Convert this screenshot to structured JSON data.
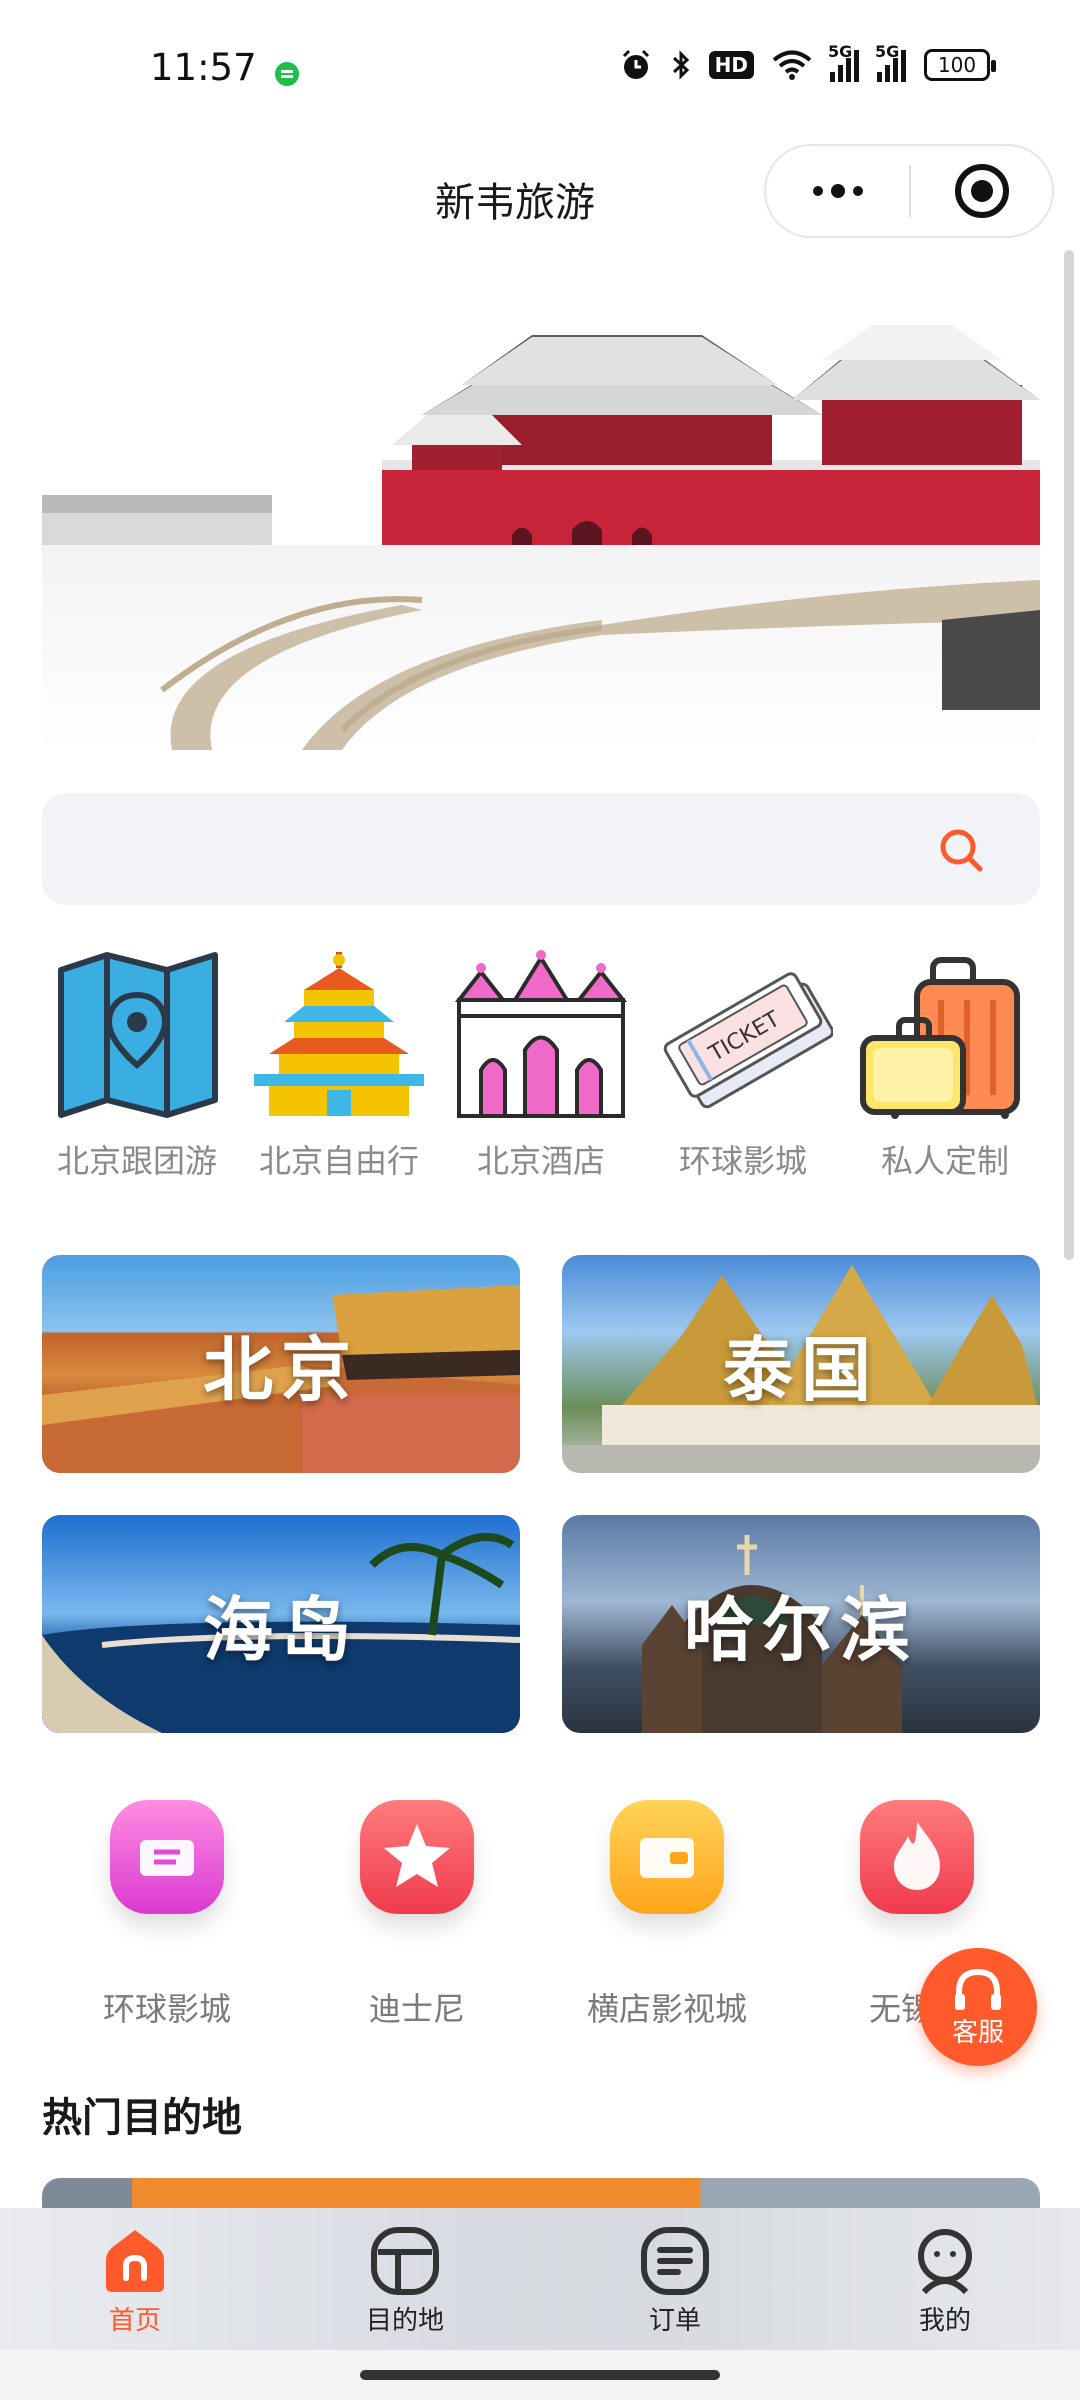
{
  "status_bar": {
    "time": "11:57",
    "hd": "HD",
    "net1": "5G",
    "net2": "5G",
    "battery": "100"
  },
  "header": {
    "title": "新韦旅游"
  },
  "search": {
    "placeholder": ""
  },
  "categories": [
    {
      "label": "北京跟团游",
      "icon": "map-pin-icon"
    },
    {
      "label": "北京自由行",
      "icon": "temple-of-heaven-icon"
    },
    {
      "label": "北京酒店",
      "icon": "castle-icon"
    },
    {
      "label": "环球影城",
      "icon": "ticket-icon"
    },
    {
      "label": "私人定制",
      "icon": "luggage-icon"
    }
  ],
  "destinations": [
    {
      "label": "北京"
    },
    {
      "label": "泰国"
    },
    {
      "label": "海岛"
    },
    {
      "label": "哈尔滨"
    }
  ],
  "quick_links": [
    {
      "label": "环球影城",
      "icon": "ticket-icon",
      "color": "#e14ad8"
    },
    {
      "label": "迪士尼",
      "icon": "star-icon",
      "color": "#ff4d5e"
    },
    {
      "label": "横店影视城",
      "icon": "wallet-icon",
      "color": "#ffb21f"
    },
    {
      "label": "无锡灵",
      "icon": "flame-icon",
      "color": "#ff4d5e"
    }
  ],
  "service_button": {
    "label": "客服"
  },
  "hot_section": {
    "title": "热门目的地"
  },
  "tabbar": [
    {
      "label": "首页",
      "active": true
    },
    {
      "label": "目的地",
      "active": false
    },
    {
      "label": "订单",
      "active": false
    },
    {
      "label": "我的",
      "active": false
    }
  ],
  "colors": {
    "accent": "#ff5a2c",
    "search_bg": "#f2f3f7"
  }
}
